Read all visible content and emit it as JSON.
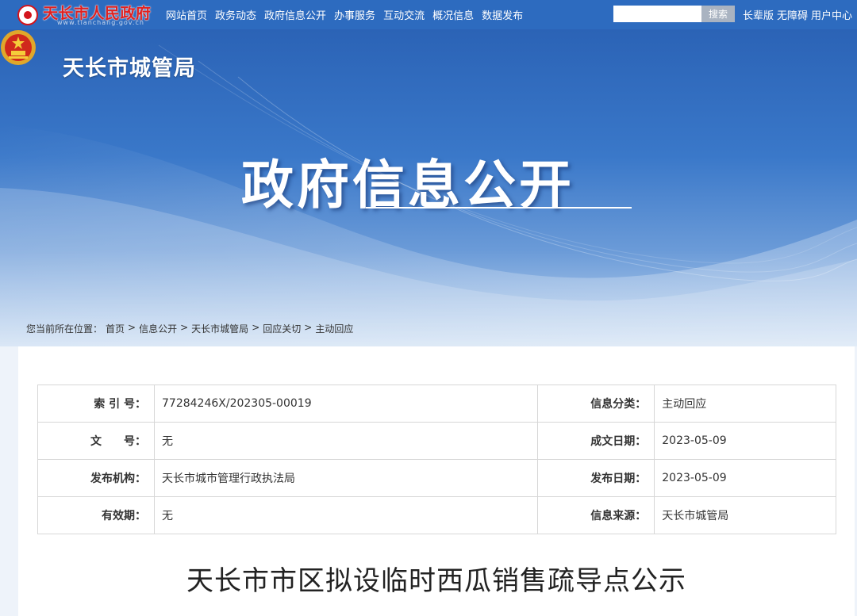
{
  "site": {
    "logo_text": "天长市人民政府",
    "logo_url_text": "www.tianchang.gov.cn"
  },
  "nav": [
    "网站首页",
    "政务动态",
    "政府信息公开",
    "办事服务",
    "互动交流",
    "概况信息",
    "数据发布"
  ],
  "search": {
    "placeholder": "",
    "button_label": "搜索"
  },
  "top_links": [
    "长辈版",
    "无障碍",
    "用户中心"
  ],
  "banner": {
    "dept_name": "天长市城管局",
    "title": "政府信息公开"
  },
  "breadcrumb": {
    "prefix": "您当前所在位置：",
    "items": [
      "首页",
      "信息公开",
      "天长市城管局",
      "回应关切",
      "主动回应"
    ],
    "separator": ">"
  },
  "meta": {
    "index_no_label": "索 引 号：",
    "index_no": "77284246X/202305-00019",
    "category_label": "信息分类：",
    "category": "主动回应",
    "doc_no_label": "文　　号：",
    "doc_no": "无",
    "created_label": "成文日期：",
    "created": "2023-05-09",
    "publisher_label": "发布机构：",
    "publisher": "天长市城市管理行政执法局",
    "published_label": "发布日期：",
    "published": "2023-05-09",
    "validity_label": "有效期：",
    "validity": "无",
    "source_label": "信息来源：",
    "source": "天长市城管局"
  },
  "article": {
    "title": "天长市市区拟设临时西瓜销售疏导点公示"
  },
  "colors": {
    "topbar": "#2d6bbf",
    "logo_red": "#e0201f",
    "banner_top": "#2b63b6"
  }
}
